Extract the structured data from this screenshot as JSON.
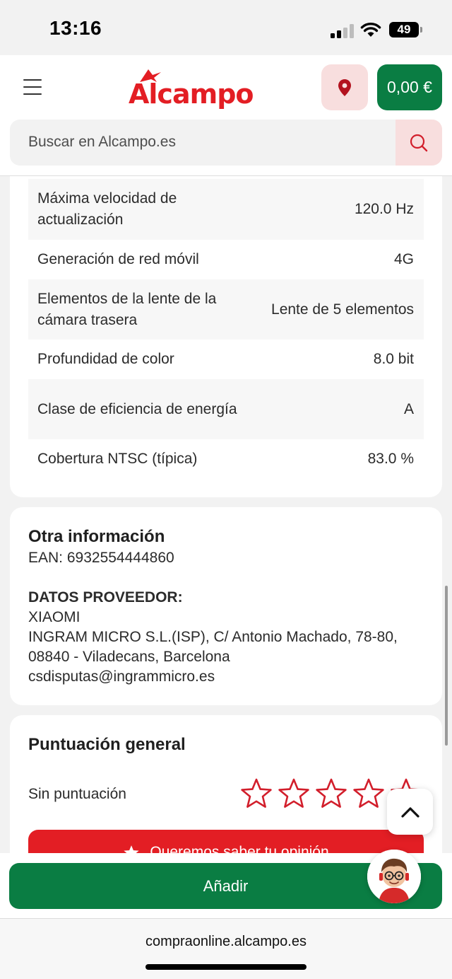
{
  "status_bar": {
    "time": "13:16",
    "battery": "49"
  },
  "header": {
    "logo": "Alcampo",
    "cart_total": "0,00 €",
    "search_placeholder": "Buscar en Alcampo.es",
    "icons": {
      "menu": "hamburger-icon",
      "location": "map-pin-icon",
      "search": "search-icon"
    }
  },
  "specs": [
    {
      "label": "Máxima velocidad de actualización",
      "value": "120.0 Hz"
    },
    {
      "label": "Generación de red móvil",
      "value": "4G"
    },
    {
      "label": "Elementos de la lente de la cámara trasera",
      "value": "Lente de 5 elementos"
    },
    {
      "label": "Profundidad de color",
      "value": "8.0 bit"
    },
    {
      "label": "Clase de eficiencia de energía",
      "value": "A"
    },
    {
      "label": "Cobertura NTSC (típica)",
      "value": "83.0 %"
    }
  ],
  "other_info": {
    "title": "Otra información",
    "ean": "EAN: 6932554444860",
    "supplier_heading": "DATOS PROVEEDOR:",
    "brand": "XIAOMI",
    "address_line1": "INGRAM MICRO S.L.(ISP), C/ Antonio Machado, 78-80,",
    "address_line2": "08840 - Viladecans, Barcelona",
    "email": "csdisputas@ingrammicro.es"
  },
  "rating": {
    "title": "Puntuación general",
    "status": "Sin puntuación",
    "stars_filled": 0,
    "stars_total": 5,
    "opinion_button": "Queremos saber tu opinión"
  },
  "actions": {
    "add_button": "Añadir"
  },
  "browser": {
    "url": "compraonline.alcampo.es"
  },
  "colors": {
    "brand_red": "#e31e24",
    "brand_green": "#0a7d43",
    "pink_bg": "#f8dede"
  }
}
